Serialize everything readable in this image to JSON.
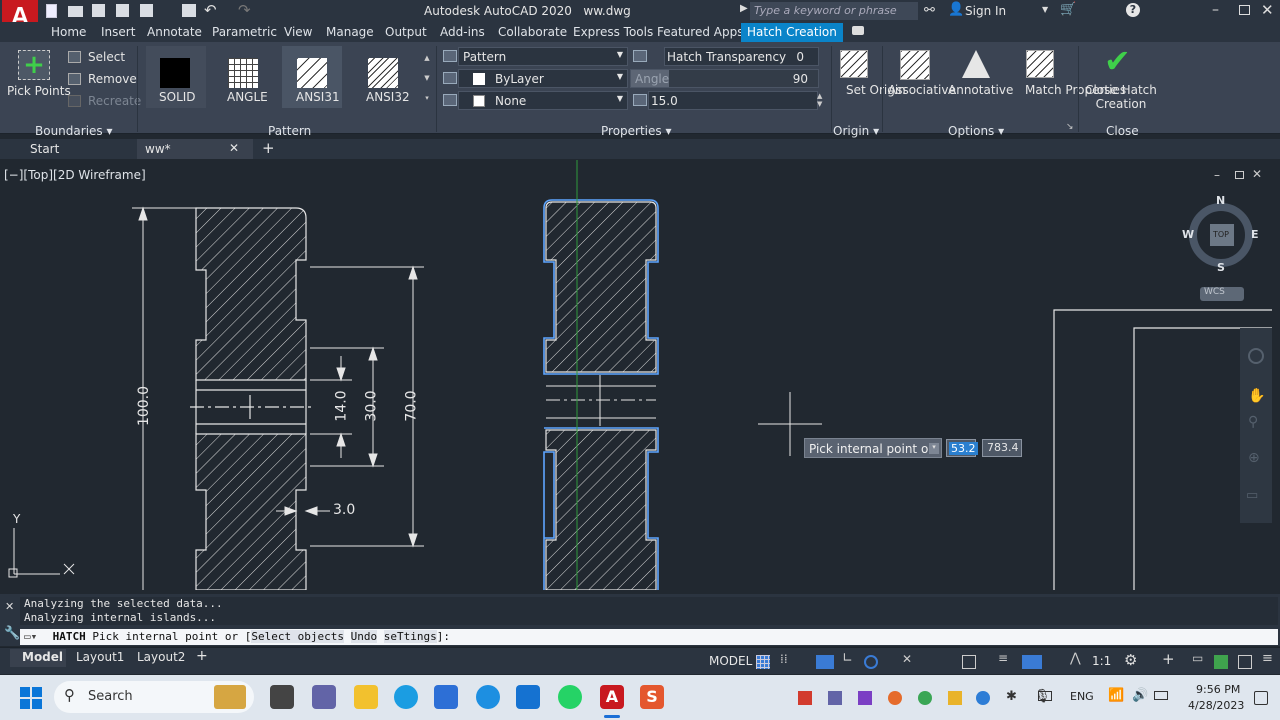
{
  "title": {
    "app": "Autodesk AutoCAD 2020",
    "file": "ww.dwg",
    "search_placeholder": "Type a keyword or phrase",
    "sign_in": "Sign In"
  },
  "ribbon_tabs": [
    "Home",
    "Insert",
    "Annotate",
    "Parametric",
    "View",
    "Manage",
    "Output",
    "Add-ins",
    "Collaborate",
    "Express Tools",
    "Featured Apps",
    "Hatch Creation"
  ],
  "boundaries": {
    "pick_points": "Pick Points",
    "select": "Select",
    "remove": "Remove",
    "recreate": "Recreate",
    "label": "Boundaries"
  },
  "pattern": {
    "items": [
      "SOLID",
      "ANGLE",
      "ANSI31",
      "ANSI32"
    ],
    "label": "Pattern"
  },
  "properties": {
    "type": "Pattern",
    "color": "ByLayer",
    "background": "None",
    "transparency_label": "Hatch Transparency",
    "transparency_value": "0",
    "angle_label": "Angle",
    "angle_value": "90",
    "scale": "15.0",
    "label": "Properties"
  },
  "origin": {
    "set_origin": "Set Origin",
    "label": "Origin"
  },
  "options": {
    "associative": "Associative",
    "annotative": "Annotative",
    "match": "Match Properties",
    "label": "Options"
  },
  "close": {
    "button": "Close Hatch Creation",
    "label": "Close"
  },
  "doc_tabs": {
    "start": "Start",
    "current": "ww*"
  },
  "viewport": {
    "label": "[−][Top][2D Wireframe]",
    "dims": {
      "d100": "100.0",
      "d14": "14.0",
      "d30": "30.0",
      "d70": "70.0",
      "d3": "3.0"
    },
    "tooltip": "Pick internal point or",
    "x_value": "53.2",
    "y_value": "783.4",
    "viewcube": {
      "n": "N",
      "s": "S",
      "e": "E",
      "w": "W",
      "top": "TOP",
      "wcs": "WCS"
    }
  },
  "command": {
    "history1": "Analyzing the selected data...",
    "history2": "Analyzing internal islands...",
    "cmd_name": "HATCH",
    "prompt": "Pick internal point or [",
    "opt1": "Select objects",
    "opt2": "Undo",
    "opt3": "seTtings",
    "end": "]:"
  },
  "layouts": [
    "Model",
    "Layout1",
    "Layout2"
  ],
  "status": {
    "model": "MODEL",
    "scale": "1:1"
  },
  "taskbar": {
    "search": "Search",
    "lang": "ENG",
    "time": "9:56 PM",
    "date": "4/28/2023"
  },
  "colors": {
    "accent": "#0a84c9",
    "hatch_selected": "#5ea6ff",
    "close_check": "#3fcf4a"
  }
}
